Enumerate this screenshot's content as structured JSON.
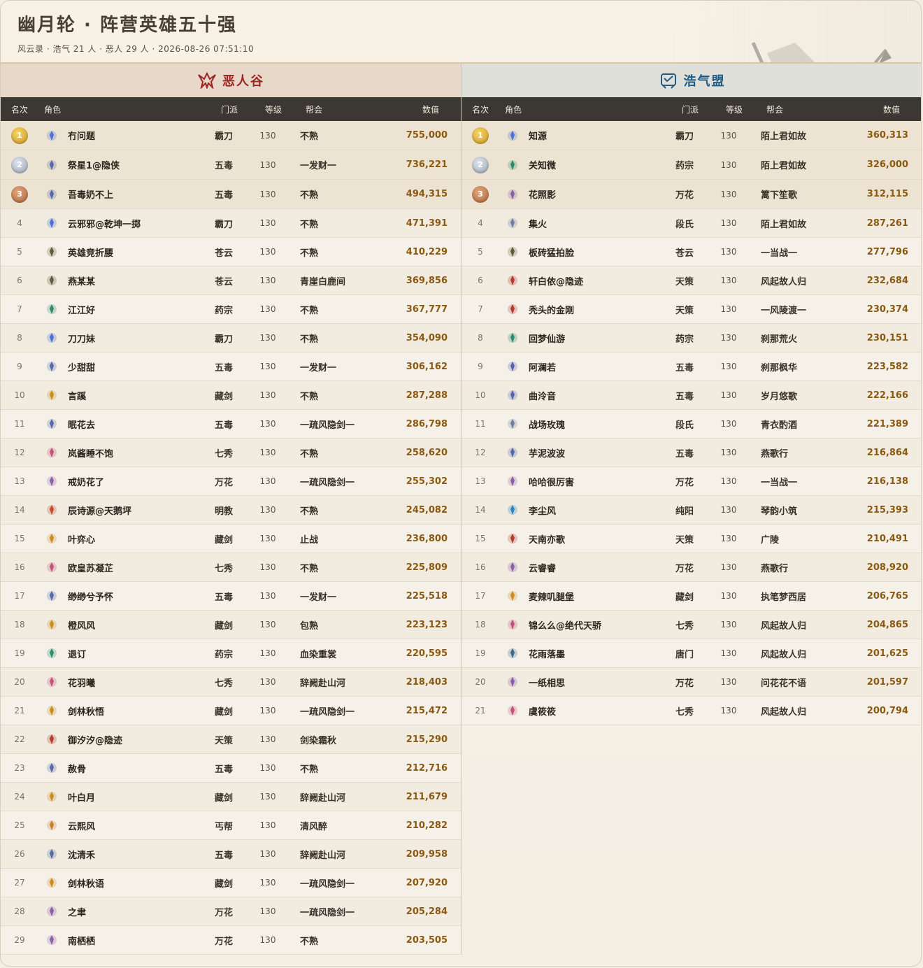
{
  "title": "幽月轮 · 阵营英雄五十强",
  "subtitle": "风云录 · 浩气 21 人 · 恶人 29 人 · 2026-08-26 07:51:10",
  "headers": {
    "rank": "名次",
    "role": "角色",
    "school": "门派",
    "level": "等级",
    "guild": "帮会",
    "value": "数值"
  },
  "colors": {
    "evil": "#9b2420",
    "hao": "#1f5a85",
    "value": "#8a5a12"
  },
  "camps": [
    {
      "name": "恶人谷",
      "icon": "evil-camp-icon",
      "rows": [
        {
          "rank": "1",
          "name": "冇问题",
          "school": "霸刀",
          "level": "130",
          "guild": "不熟",
          "value": "755,000"
        },
        {
          "rank": "2",
          "name": "祭星1@隐侠",
          "school": "五毒",
          "level": "130",
          "guild": "一发财一",
          "value": "736,221"
        },
        {
          "rank": "3",
          "name": "吾毒奶不上",
          "school": "五毒",
          "level": "130",
          "guild": "不熟",
          "value": "494,315"
        },
        {
          "rank": "4",
          "name": "云邪邪@乾坤一掷",
          "school": "霸刀",
          "level": "130",
          "guild": "不熟",
          "value": "471,391"
        },
        {
          "rank": "5",
          "name": "英雄竞折腰",
          "school": "苍云",
          "level": "130",
          "guild": "不熟",
          "value": "410,229"
        },
        {
          "rank": "6",
          "name": "燕某某",
          "school": "苍云",
          "level": "130",
          "guild": "青崖白鹿间",
          "value": "369,856"
        },
        {
          "rank": "7",
          "name": "江江好",
          "school": "药宗",
          "level": "130",
          "guild": "不熟",
          "value": "367,777"
        },
        {
          "rank": "8",
          "name": "刀刀妹",
          "school": "霸刀",
          "level": "130",
          "guild": "不熟",
          "value": "354,090"
        },
        {
          "rank": "9",
          "name": "少甜甜",
          "school": "五毒",
          "level": "130",
          "guild": "一发财一",
          "value": "306,162"
        },
        {
          "rank": "10",
          "name": "言蹊",
          "school": "藏剑",
          "level": "130",
          "guild": "不熟",
          "value": "287,288"
        },
        {
          "rank": "11",
          "name": "眠花去",
          "school": "五毒",
          "level": "130",
          "guild": "一疏风隐剑一",
          "value": "286,798"
        },
        {
          "rank": "12",
          "name": "岚酱睡不饱",
          "school": "七秀",
          "level": "130",
          "guild": "不熟",
          "value": "258,620"
        },
        {
          "rank": "13",
          "name": "戒奶花了",
          "school": "万花",
          "level": "130",
          "guild": "一疏风隐剑一",
          "value": "255,302"
        },
        {
          "rank": "14",
          "name": "辰诗源@天鹅坪",
          "school": "明教",
          "level": "130",
          "guild": "不熟",
          "value": "245,082"
        },
        {
          "rank": "15",
          "name": "叶弈心",
          "school": "藏剑",
          "level": "130",
          "guild": "止战",
          "value": "236,800"
        },
        {
          "rank": "16",
          "name": "欧皇苏凝芷",
          "school": "七秀",
          "level": "130",
          "guild": "不熟",
          "value": "225,809"
        },
        {
          "rank": "17",
          "name": "缈缈兮予怀",
          "school": "五毒",
          "level": "130",
          "guild": "一发财一",
          "value": "225,518"
        },
        {
          "rank": "18",
          "name": "橙风风",
          "school": "藏剑",
          "level": "130",
          "guild": "包熟",
          "value": "223,123"
        },
        {
          "rank": "19",
          "name": "退订",
          "school": "药宗",
          "level": "130",
          "guild": "血染重裳",
          "value": "220,595"
        },
        {
          "rank": "20",
          "name": "花羽曦",
          "school": "七秀",
          "level": "130",
          "guild": "辞阙赴山河",
          "value": "218,403"
        },
        {
          "rank": "21",
          "name": "剑林秋悟",
          "school": "藏剑",
          "level": "130",
          "guild": "一疏风隐剑一",
          "value": "215,472"
        },
        {
          "rank": "22",
          "name": "御汐汐@隐迹",
          "school": "天策",
          "level": "130",
          "guild": "剑染霜秋",
          "value": "215,290"
        },
        {
          "rank": "23",
          "name": "赦骨",
          "school": "五毒",
          "level": "130",
          "guild": "不熟",
          "value": "212,716"
        },
        {
          "rank": "24",
          "name": "叶白月",
          "school": "藏剑",
          "level": "130",
          "guild": "辞阙赴山河",
          "value": "211,679"
        },
        {
          "rank": "25",
          "name": "云熙风",
          "school": "丐帮",
          "level": "130",
          "guild": "清风醉",
          "value": "210,282"
        },
        {
          "rank": "26",
          "name": "沈清禾",
          "school": "五毒",
          "level": "130",
          "guild": "辞阙赴山河",
          "value": "209,958"
        },
        {
          "rank": "27",
          "name": "剑林秋语",
          "school": "藏剑",
          "level": "130",
          "guild": "一疏风隐剑一",
          "value": "207,920"
        },
        {
          "rank": "28",
          "name": "之聿",
          "school": "万花",
          "level": "130",
          "guild": "一疏风隐剑一",
          "value": "205,284"
        },
        {
          "rank": "29",
          "name": "南栖栖",
          "school": "万花",
          "level": "130",
          "guild": "不熟",
          "value": "203,505"
        }
      ]
    },
    {
      "name": "浩气盟",
      "icon": "haoqi-camp-icon",
      "rows": [
        {
          "rank": "1",
          "name": "知源",
          "school": "霸刀",
          "level": "130",
          "guild": "陌上君如故",
          "value": "360,313"
        },
        {
          "rank": "2",
          "name": "关知微",
          "school": "药宗",
          "level": "130",
          "guild": "陌上君如故",
          "value": "326,000"
        },
        {
          "rank": "3",
          "name": "花照影",
          "school": "万花",
          "level": "130",
          "guild": "篱下笙歌",
          "value": "312,115"
        },
        {
          "rank": "4",
          "name": "集火",
          "school": "段氏",
          "level": "130",
          "guild": "陌上君如故",
          "value": "287,261"
        },
        {
          "rank": "5",
          "name": "板砖猛拍脸",
          "school": "苍云",
          "level": "130",
          "guild": "一当战一",
          "value": "277,796"
        },
        {
          "rank": "6",
          "name": "轩白依@隐迹",
          "school": "天策",
          "level": "130",
          "guild": "风起故人归",
          "value": "232,684"
        },
        {
          "rank": "7",
          "name": "秃头的金刚",
          "school": "天策",
          "level": "130",
          "guild": "一风陵渡一",
          "value": "230,374"
        },
        {
          "rank": "8",
          "name": "回梦仙游",
          "school": "药宗",
          "level": "130",
          "guild": "刹那荒火",
          "value": "230,151"
        },
        {
          "rank": "9",
          "name": "阿澜若",
          "school": "五毒",
          "level": "130",
          "guild": "刹那枫华",
          "value": "223,582"
        },
        {
          "rank": "10",
          "name": "曲泠音",
          "school": "五毒",
          "level": "130",
          "guild": "岁月悠歌",
          "value": "222,166"
        },
        {
          "rank": "11",
          "name": "战场玫瑰",
          "school": "段氏",
          "level": "130",
          "guild": "青衣酌酒",
          "value": "221,389"
        },
        {
          "rank": "12",
          "name": "芋泥波波",
          "school": "五毒",
          "level": "130",
          "guild": "燕歌行",
          "value": "216,864"
        },
        {
          "rank": "13",
          "name": "哈哈很厉害",
          "school": "万花",
          "level": "130",
          "guild": "一当战一",
          "value": "216,138"
        },
        {
          "rank": "14",
          "name": "李尘风",
          "school": "纯阳",
          "level": "130",
          "guild": "琴韵小筑",
          "value": "215,393"
        },
        {
          "rank": "15",
          "name": "天南亦歌",
          "school": "天策",
          "level": "130",
          "guild": "广陵",
          "value": "210,491"
        },
        {
          "rank": "16",
          "name": "云睿睿",
          "school": "万花",
          "level": "130",
          "guild": "燕歌行",
          "value": "208,920"
        },
        {
          "rank": "17",
          "name": "麦辣叽腿堡",
          "school": "藏剑",
          "level": "130",
          "guild": "执笔梦西居",
          "value": "206,765"
        },
        {
          "rank": "18",
          "name": "锦么么@绝代天骄",
          "school": "七秀",
          "level": "130",
          "guild": "风起故人归",
          "value": "204,865"
        },
        {
          "rank": "19",
          "name": "花雨落墨",
          "school": "唐门",
          "level": "130",
          "guild": "风起故人归",
          "value": "201,625"
        },
        {
          "rank": "20",
          "name": "一纸相思",
          "school": "万花",
          "level": "130",
          "guild": "问花花不语",
          "value": "201,597"
        },
        {
          "rank": "21",
          "name": "虞筱筱",
          "school": "七秀",
          "level": "130",
          "guild": "风起故人归",
          "value": "200,794"
        }
      ]
    }
  ]
}
